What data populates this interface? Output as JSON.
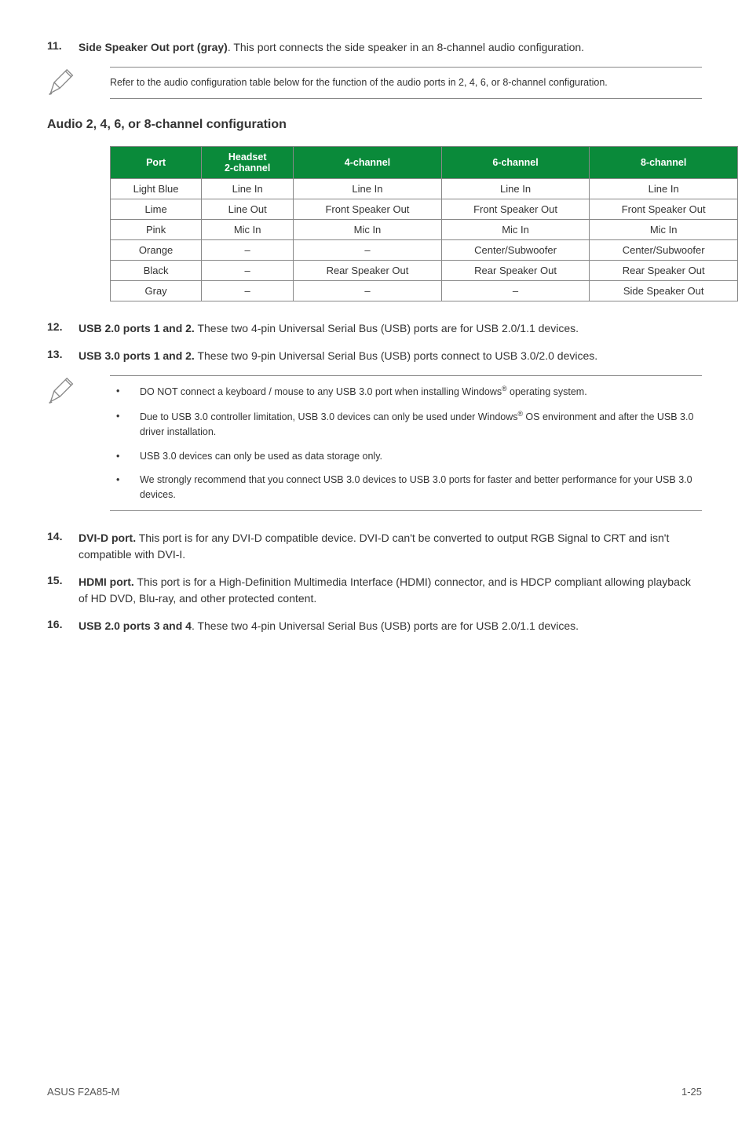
{
  "items": {
    "i11": {
      "num": "11.",
      "title": "Side Speaker Out port (gray)",
      "text": ". This port connects the side speaker in an 8-channel audio configuration."
    },
    "i12": {
      "num": "12.",
      "title": "USB 2.0 ports 1 and 2.",
      "text": " These two 4-pin Universal Serial Bus (USB) ports are for USB 2.0/1.1 devices."
    },
    "i13": {
      "num": "13.",
      "title": "USB 3.0 ports 1 and 2.",
      "text": " These two 9-pin Universal Serial Bus (USB) ports connect to USB 3.0/2.0 devices."
    },
    "i14": {
      "num": "14.",
      "title": "DVI-D port.",
      "text": " This port is for any DVI-D compatible device. DVI-D can't be converted to output RGB Signal to CRT and isn't compatible with DVI-I."
    },
    "i15": {
      "num": "15.",
      "title": "HDMI port.",
      "text": " This port is for a High-Definition Multimedia Interface (HDMI) connector, and is HDCP compliant allowing playback of HD DVD, Blu-ray, and other protected content."
    },
    "i16": {
      "num": "16.",
      "title": "USB 2.0 ports 3 and 4",
      "text": ". These two 4-pin Universal Serial Bus (USB) ports are for USB 2.0/1.1 devices."
    }
  },
  "note1": "Refer to the audio configuration table below for the function of the audio ports in 2, 4, 6, or 8-channel configuration.",
  "heading": "Audio 2, 4, 6, or 8-channel configuration",
  "table": {
    "headers": [
      "Port",
      "Headset 2-channel",
      "4-channel",
      "6-channel",
      "8-channel"
    ],
    "rows": [
      [
        "Light Blue",
        "Line In",
        "Line In",
        "Line In",
        "Line In"
      ],
      [
        "Lime",
        "Line Out",
        "Front Speaker Out",
        "Front Speaker Out",
        "Front Speaker Out"
      ],
      [
        "Pink",
        "Mic In",
        "Mic In",
        "Mic In",
        "Mic In"
      ],
      [
        "Orange",
        "–",
        "–",
        "Center/Subwoofer",
        "Center/Subwoofer"
      ],
      [
        "Black",
        "–",
        "Rear Speaker Out",
        "Rear Speaker Out",
        "Rear Speaker Out"
      ],
      [
        "Gray",
        "–",
        "–",
        "–",
        "Side Speaker Out"
      ]
    ]
  },
  "note2": {
    "b1a": "DO NOT connect a keyboard / mouse to any USB 3.0 port when installing Windows",
    "b1b": " operating system.",
    "b2a": "Due to USB 3.0 controller limitation, USB 3.0 devices can only be used under Windows",
    "b2b": " OS environment and after the USB 3.0 driver installation.",
    "b3": "USB 3.0 devices can only be used as data storage only.",
    "b4": "We strongly recommend that you connect USB 3.0 devices to USB 3.0 ports for faster and better performance for your USB 3.0 devices."
  },
  "footer": {
    "left": "ASUS F2A85-M",
    "right": "1-25"
  },
  "reg": "®"
}
